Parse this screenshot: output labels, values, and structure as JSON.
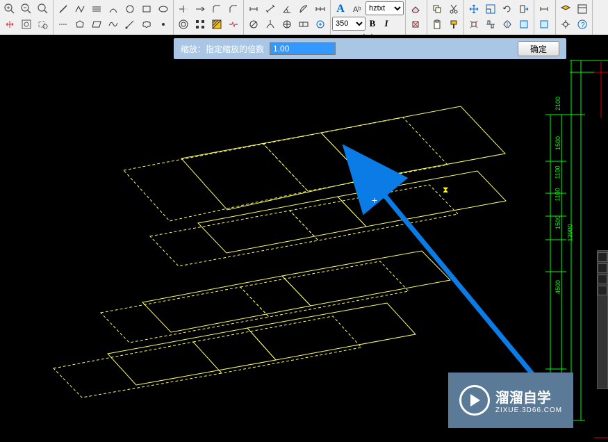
{
  "toolbar": {
    "line_label": "直线",
    "dimension_label": "标注",
    "text_label": "文字",
    "font_name": "hztxt",
    "font_size": "350",
    "delete_label": "删除",
    "measure_label": "测量",
    "bold_label": "B",
    "italic_label": "I",
    "text_a_label": "A"
  },
  "prompt": {
    "label": "缩放：指定缩放的倍数",
    "value": "1.00",
    "confirm": "确定"
  },
  "dimensions": {
    "overall": "13900",
    "d1": "2100",
    "d2": "1500",
    "d3": "1100",
    "d4": "1100",
    "d5": "1500",
    "d6": "4500"
  },
  "watermark": {
    "title": "溜溜自学",
    "subtitle": "ZIXUE.3D66.COM"
  },
  "cursor": {
    "symbol": "+"
  },
  "hourglass": {
    "symbol": "⧗"
  }
}
